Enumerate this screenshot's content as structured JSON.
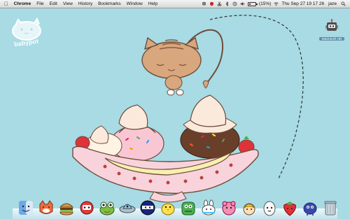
{
  "menubar": {
    "apple_icon": "apple-logo-icon",
    "app_name": "Chrome",
    "menus": [
      "File",
      "Edit",
      "View",
      "History",
      "Bookmarks",
      "Window",
      "Help"
    ],
    "battery_percent": "(15%)",
    "clock": "Thu Sep 27  19 17 26",
    "user": "jaze",
    "status_icons": [
      "dropbox-icon",
      "shield-icon",
      "scissors-icon",
      "bluetooth-icon",
      "time-machine-icon",
      "volume-icon",
      "battery-icon",
      "wifi-icon",
      "search-icon"
    ]
  },
  "desktop": {
    "logo_text": "babypot",
    "drive_label": "Macintosh HD",
    "wallpaper_colors": {
      "sky": "#a8dbe4",
      "cat": "#d9a77d",
      "bowl": "#f8d3dc",
      "banana": "#f7f0b0",
      "strawberry": "#e0323a"
    }
  },
  "dock": {
    "items": [
      {
        "name": "finder-icon"
      },
      {
        "name": "fox-app-icon"
      },
      {
        "name": "burger-app-icon"
      },
      {
        "name": "red-robot-app-icon"
      },
      {
        "name": "frog-app-icon"
      },
      {
        "name": "ufo-app-icon"
      },
      {
        "name": "ninja-app-icon"
      },
      {
        "name": "chick-app-icon"
      },
      {
        "name": "green-monster-app-icon"
      },
      {
        "name": "bunny-app-icon"
      },
      {
        "name": "pink-creature-app-icon"
      },
      {
        "name": "blonde-kid-app-icon"
      },
      {
        "name": "egg-app-icon"
      },
      {
        "name": "strawberry-app-icon"
      },
      {
        "name": "blue-bug-app-icon"
      },
      {
        "name": "trash-icon"
      }
    ]
  }
}
